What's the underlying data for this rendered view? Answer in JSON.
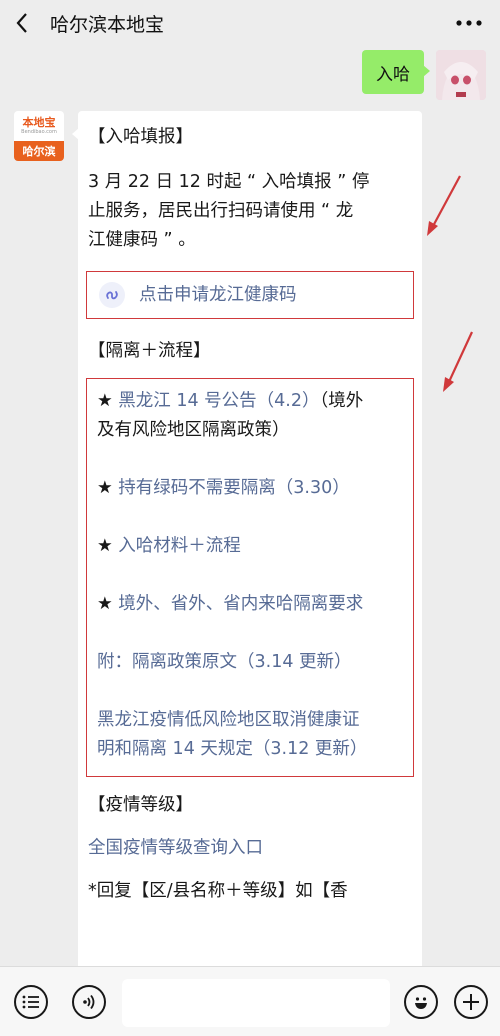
{
  "header": {
    "title": "哈尔滨本地宝",
    "icons": {
      "back": "chevron-left-icon",
      "more": "more-dots-icon"
    }
  },
  "outgoing_message": {
    "text": "入哈"
  },
  "bot": {
    "logo_text": "本地宝",
    "logo_sub": "Bendibao.com",
    "city_label": "哈尔滨"
  },
  "incoming_message": {
    "title1": "【入哈填报】",
    "notice_lines": [
      "3 月 22 日 12 时起 “ 入哈填报 ” 停",
      "止服务，居民出行扫码请使用 “ 龙",
      "江健康码 ” 。"
    ],
    "miniprogram_link": "点击申请龙江健康码",
    "title2": "【隔离＋流程】",
    "item1_star": "★ ",
    "item1_link": "黑龙江 14 号公告（4.2）",
    "item1_tail": "（境外",
    "item1_line2": "及有风险地区隔离政策）",
    "item2_star": "★ ",
    "item2_link": "持有绿码不需要隔离（3.30）",
    "item3_star": "★ ",
    "item3_link": "入哈材料＋流程",
    "item4_star": "★ ",
    "item4_link": "境外、省外、省内来哈隔离要求",
    "item5_link": "附：隔离政策原文（3.14 更新）",
    "item6_line1": "黑龙江疫情低风险地区取消健康证",
    "item6_line2": "明和隔离 14 天规定（3.12 更新）",
    "title3": "【疫情等级】",
    "level_link": "全国疫情等级查询入口",
    "reply_partial": "*回复【区/县名称＋等级】如【香"
  },
  "bottom_bar": {
    "icons": [
      "menu-list-icon",
      "voice-icon",
      "emoji-icon",
      "plus-icon"
    ]
  },
  "colors": {
    "link": "#576b95",
    "highlight_border": "#d0393b",
    "outgoing_bubble": "#95ec69",
    "logo_orange": "#e8611e"
  }
}
